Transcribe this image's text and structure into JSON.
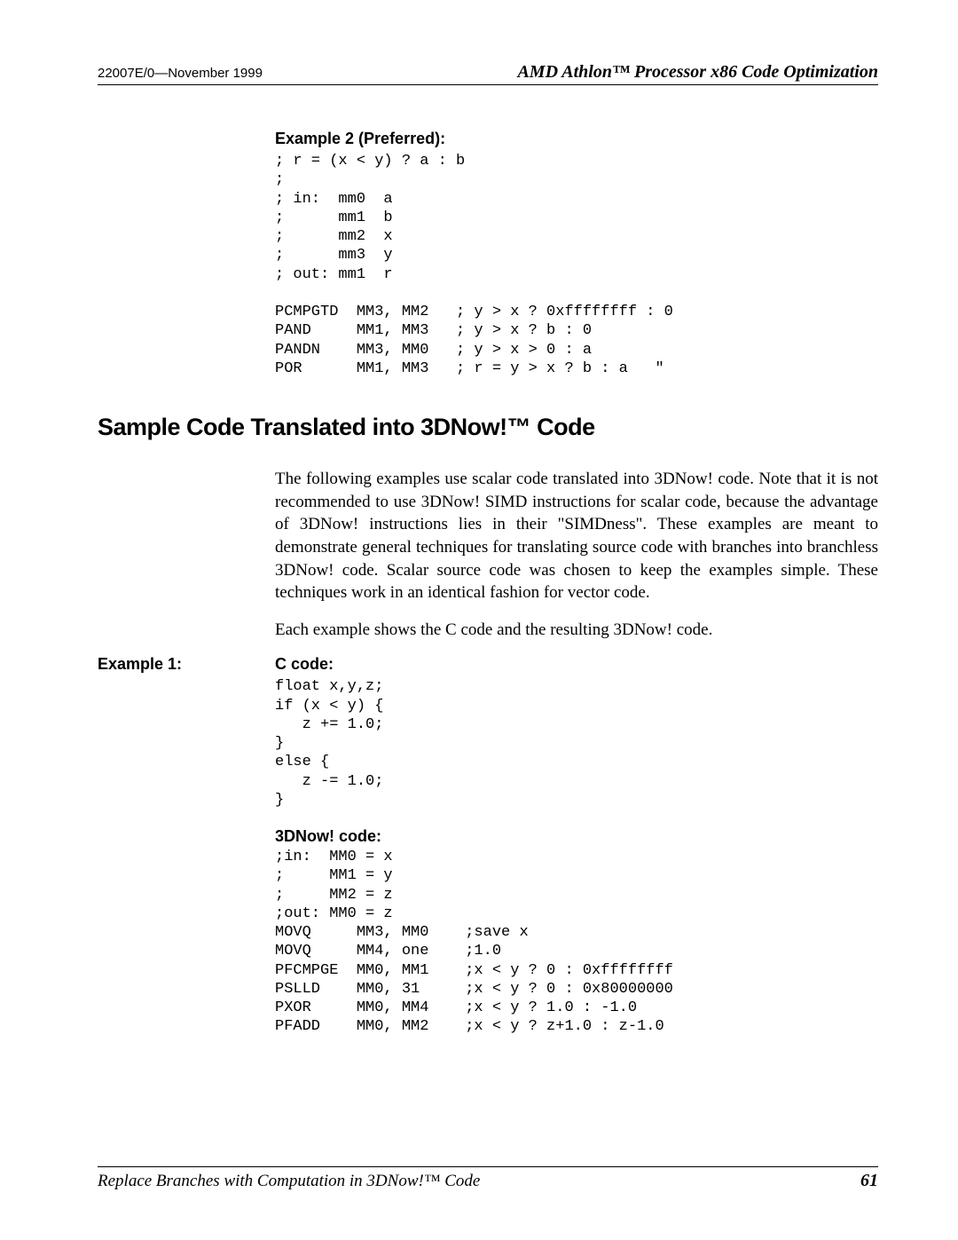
{
  "header": {
    "docId": "22007E/0—November 1999",
    "title": "AMD Athlon™ Processor x86 Code Optimization"
  },
  "example2": {
    "heading": "Example 2 (Preferred):",
    "code": "; r = (x < y) ? a : b\n;\n; in:  mm0  a\n;      mm1  b\n;      mm2  x\n;      mm3  y\n; out: mm1  r\n\nPCMPGTD  MM3, MM2   ; y > x ? 0xffffffff : 0\nPAND     MM1, MM3   ; y > x ? b : 0\nPANDN    MM3, MM0   ; y > x > 0 : a\nPOR      MM1, MM3   ; r = y > x ? b : a   \""
  },
  "section": {
    "heading": "Sample Code Translated into 3DNow!™ Code",
    "para1": "The following examples use scalar code translated into 3DNow! code. Note that it is not recommended to use 3DNow! SIMD instructions for scalar code, because the advantage of 3DNow! instructions lies in their \"SIMDness\". These examples are meant to demonstrate general techniques for translating source code with branches into branchless 3DNow! code. Scalar source code was chosen to keep the examples simple. These techniques work in an identical fashion for vector code.",
    "para2": "Each example shows the C code and the resulting 3DNow! code."
  },
  "example1": {
    "label": "Example 1:",
    "cHeading": "C code:",
    "cCode": "float x,y,z;\nif (x < y) {\n   z += 1.0;\n}\nelse {\n   z -= 1.0;\n}",
    "dHeading": "3DNow! code:",
    "dCode": ";in:  MM0 = x\n;     MM1 = y\n;     MM2 = z\n;out: MM0 = z\nMOVQ     MM3, MM0    ;save x\nMOVQ     MM4, one    ;1.0\nPFCMPGE  MM0, MM1    ;x < y ? 0 : 0xffffffff\nPSLLD    MM0, 31     ;x < y ? 0 : 0x80000000\nPXOR     MM0, MM4    ;x < y ? 1.0 : -1.0\nPFADD    MM0, MM2    ;x < y ? z+1.0 : z-1.0"
  },
  "footer": {
    "title": "Replace Branches with Computation in 3DNow!™ Code",
    "page": "61"
  }
}
